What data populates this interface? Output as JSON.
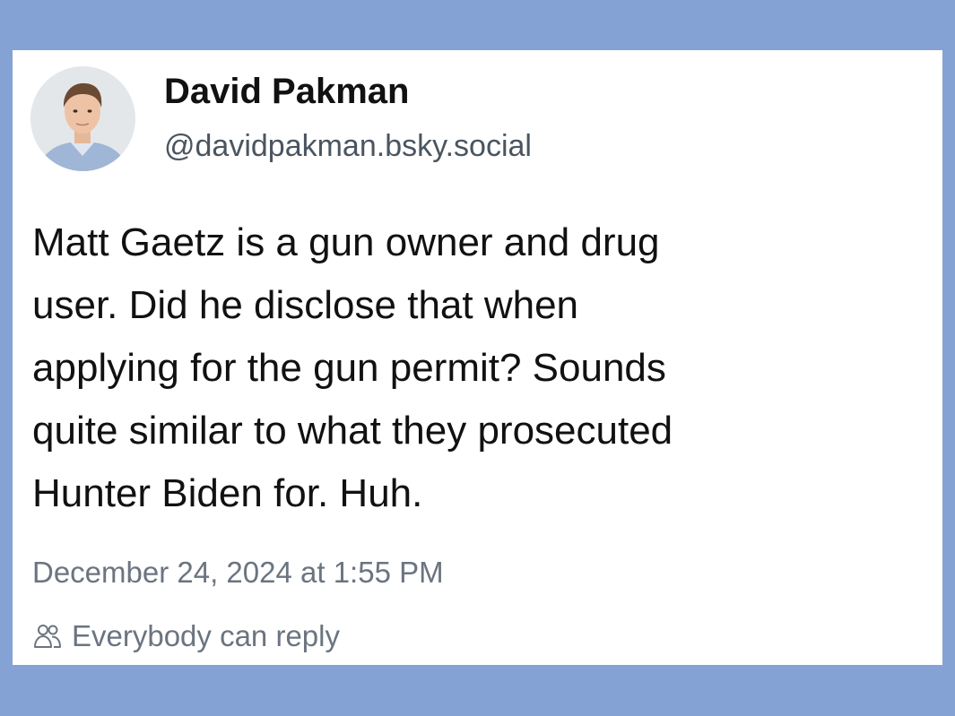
{
  "post": {
    "author": {
      "display_name": "David Pakman",
      "handle": "@davidpakman.bsky.social",
      "avatar_icon": "profile-photo"
    },
    "text_lines": [
      "Matt Gaetz is a gun owner and drug",
      "user. Did he disclose that when",
      "applying for the gun permit? Sounds",
      "quite similar to what they prosecuted",
      "Hunter Biden for. Huh."
    ],
    "timestamp": "December 24, 2024 at 1:55 PM",
    "reply_setting": {
      "icon": "people-icon",
      "label": "Everybody can reply"
    }
  },
  "colors": {
    "page_background": "#84a2d4",
    "card_background": "#ffffff",
    "primary_text": "#111111",
    "secondary_text": "#6b7480"
  }
}
